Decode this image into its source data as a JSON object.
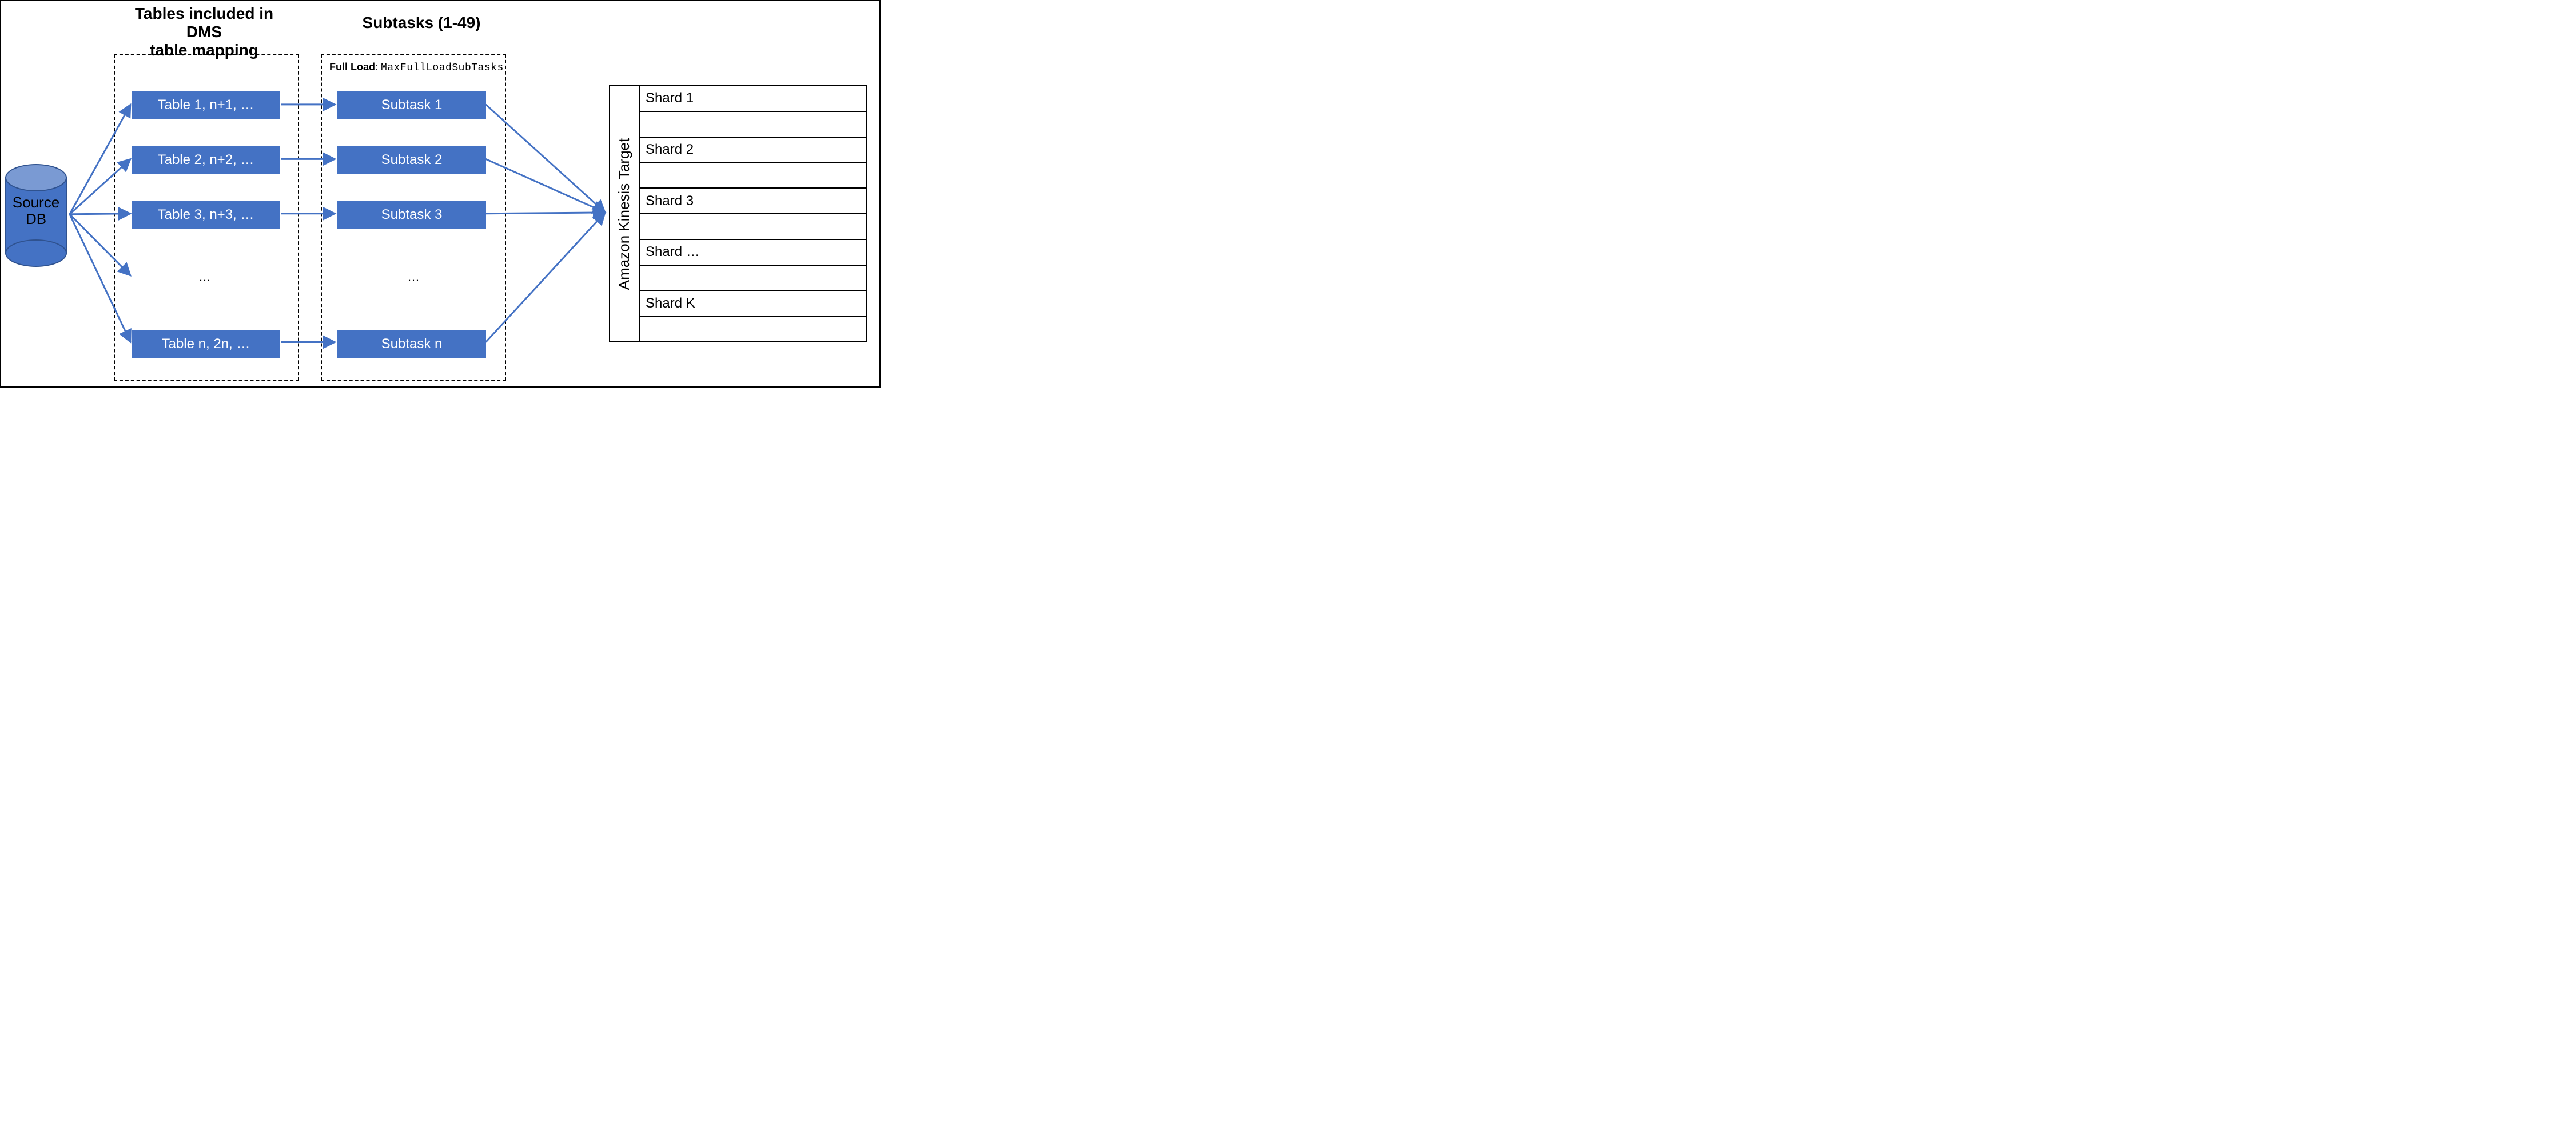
{
  "titles": {
    "tables": "Tables included in DMS\ntable mapping",
    "subtasks": "Subtasks (1-49)"
  },
  "source_db": "Source\nDB",
  "full_load_caption": {
    "bold": "Full Load",
    "rest_mono": "MaxFullLoadSubTasks"
  },
  "tables": [
    "Table 1, n+1, …",
    "Table 2, n+2, …",
    "Table 3, n+3, …",
    "Table n, 2n, …"
  ],
  "subtasks": [
    "Subtask 1",
    "Subtask 2",
    "Subtask 3",
    "Subtask n"
  ],
  "ellipsis": "…",
  "kinesis": {
    "header": "Amazon Kinesis Target",
    "shards": [
      "Shard 1",
      "",
      "Shard 2",
      "",
      "Shard 3",
      "",
      "Shard …",
      "",
      "Shard K",
      ""
    ]
  },
  "colors": {
    "blue": "#4472c4",
    "blue_border": "#2f528f"
  }
}
